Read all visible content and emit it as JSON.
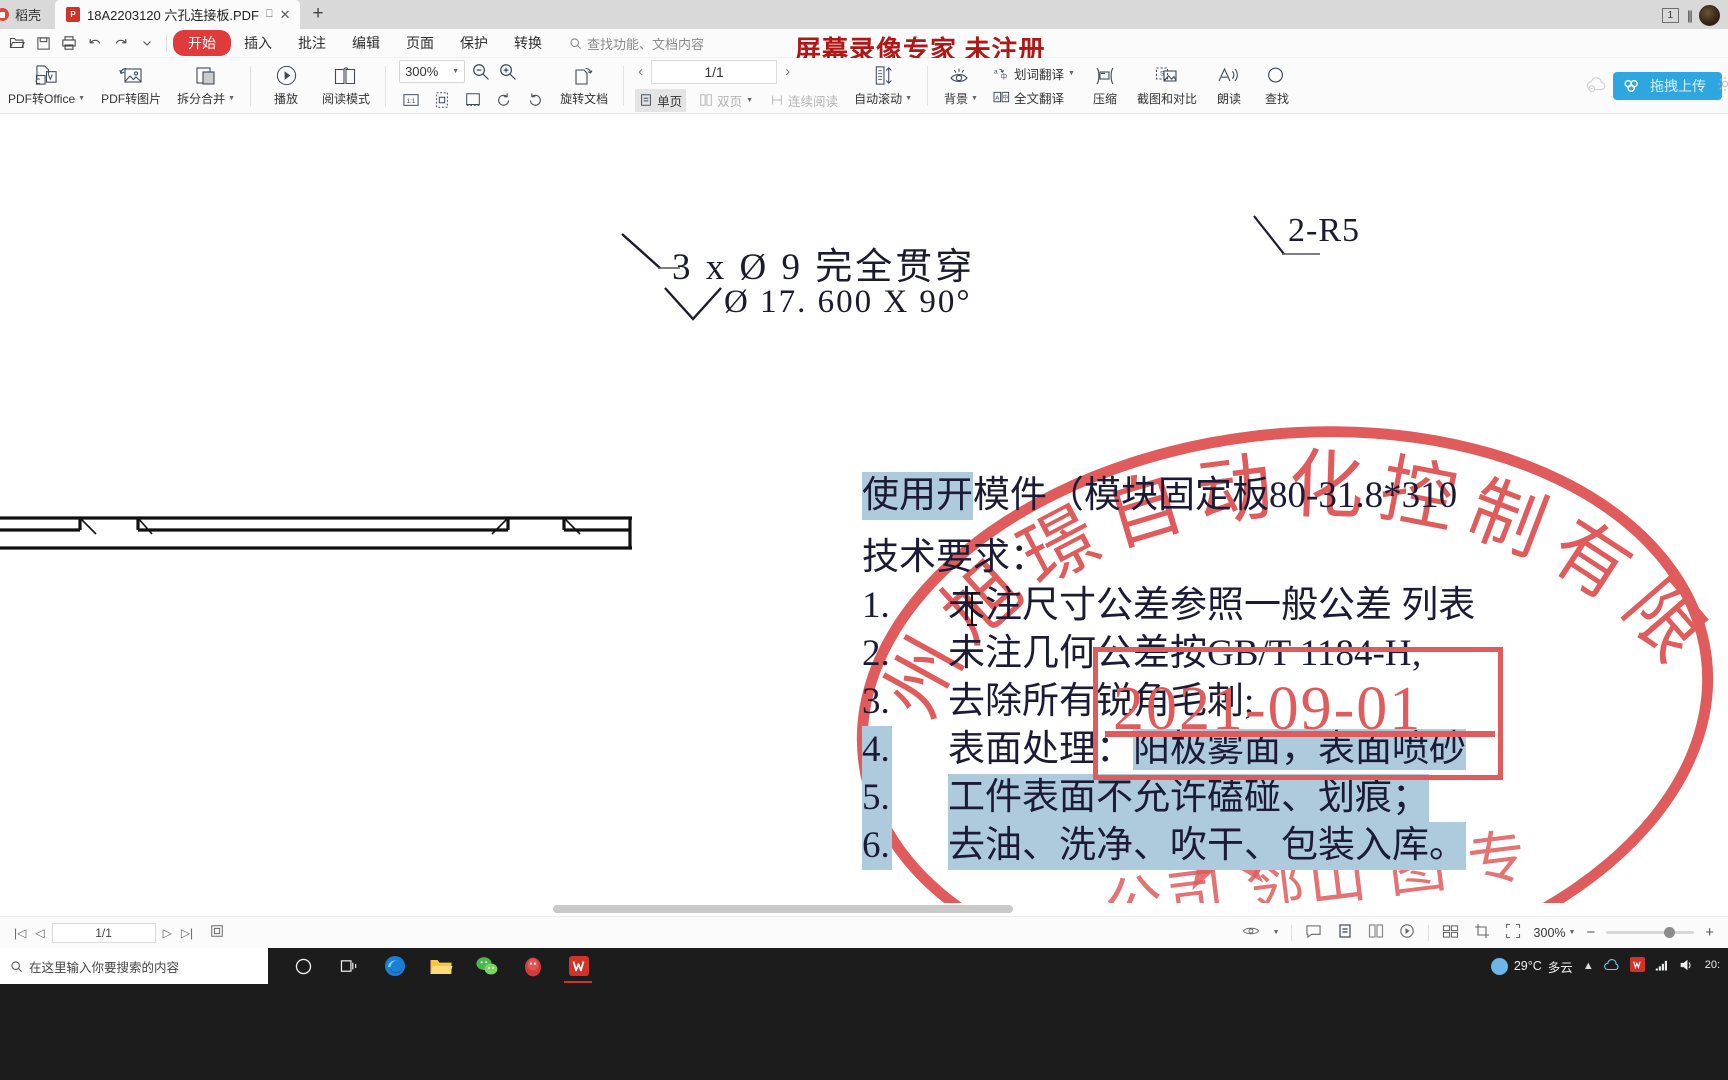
{
  "tabbar": {
    "app_name": "稻壳",
    "document_tab": "18A2203120 六孔连接板.PDF",
    "new_tab_label": "+",
    "window_count": "1"
  },
  "menubar": {
    "items": [
      {
        "label": "开始",
        "active": true
      },
      {
        "label": "插入",
        "active": false
      },
      {
        "label": "批注",
        "active": false
      },
      {
        "label": "编辑",
        "active": false
      },
      {
        "label": "页面",
        "active": false
      },
      {
        "label": "保护",
        "active": false
      },
      {
        "label": "转换",
        "active": false
      }
    ],
    "search_placeholder": "查找功能、文档内容",
    "watermark_title": "屏幕录像专家  未注册",
    "upload_label": "拖拽上传"
  },
  "ribbon": {
    "pdf_to_office": "PDF转Office",
    "pdf_to_image": "PDF转图片",
    "split_merge": "拆分合并",
    "play": "播放",
    "read_mode": "阅读模式",
    "zoom_value": "300%",
    "rotate_doc": "旋转文档",
    "page_indicator": "1/1",
    "single_page": "单页",
    "double_page": "双页",
    "continuous_read": "连续阅读",
    "auto_scroll": "自动滚动",
    "background": "背景",
    "word_translate": "划词翻译",
    "full_translate": "全文翻译",
    "compress": "压缩",
    "screenshot_compare": "截图和对比",
    "read_aloud": "朗读",
    "find": "查找"
  },
  "document": {
    "annotation_hole": "3 x  Ø  9  完全贯穿",
    "annotation_csink": "Ø  17. 600  X  90°",
    "annotation_radius": "2-R5",
    "body_lines": [
      {
        "num": "",
        "text": "使用开模件（模块固定板80-31.8*310",
        "highlight_head": "使用开",
        "highlight_num": false
      },
      {
        "num": "",
        "text": "技术要求：",
        "highlight_head": "",
        "highlight_num": false
      },
      {
        "num": "1.",
        "text": "未注尺寸公差参照一般公差 列表",
        "highlight_head": "",
        "highlight_num": false
      },
      {
        "num": "2.",
        "text": "未注几何公差按GB/T 1184-H;",
        "highlight_head": "",
        "highlight_num": false
      },
      {
        "num": "3.",
        "text": "去除所有锐角毛刺;",
        "highlight_head": "",
        "highlight_num": false
      },
      {
        "num": "4.",
        "text": "表面处理：阳极雾面，表面喷砂",
        "highlight_head": "",
        "highlight_num": true
      },
      {
        "num": "5.",
        "text": "工件表面不允许磕碰、划痕；",
        "highlight_head": "",
        "highlight_num": true
      },
      {
        "num": "6.",
        "text": "去油、洗净、吹干、包装入库。",
        "highlight_head": "",
        "highlight_num": true
      }
    ],
    "stamp_text": "州旭璟自动化控制有限",
    "stamp_bottom_text": "公司 邻山 图 专",
    "stamp_date": "2021-09-01"
  },
  "statusbar": {
    "page_current": "1/1",
    "zoom_level": "300%",
    "minus": "−",
    "plus": "+"
  },
  "taskbar": {
    "search_placeholder": "在这里输入你要搜索的内容",
    "temperature": "29°C",
    "weather": "多云",
    "time": "20:"
  },
  "colors": {
    "accent_red": "#e03b3b",
    "stamp_red": "#e05c5c",
    "watermark_red": "#b01717",
    "selection_blue": "#aecbdd"
  }
}
